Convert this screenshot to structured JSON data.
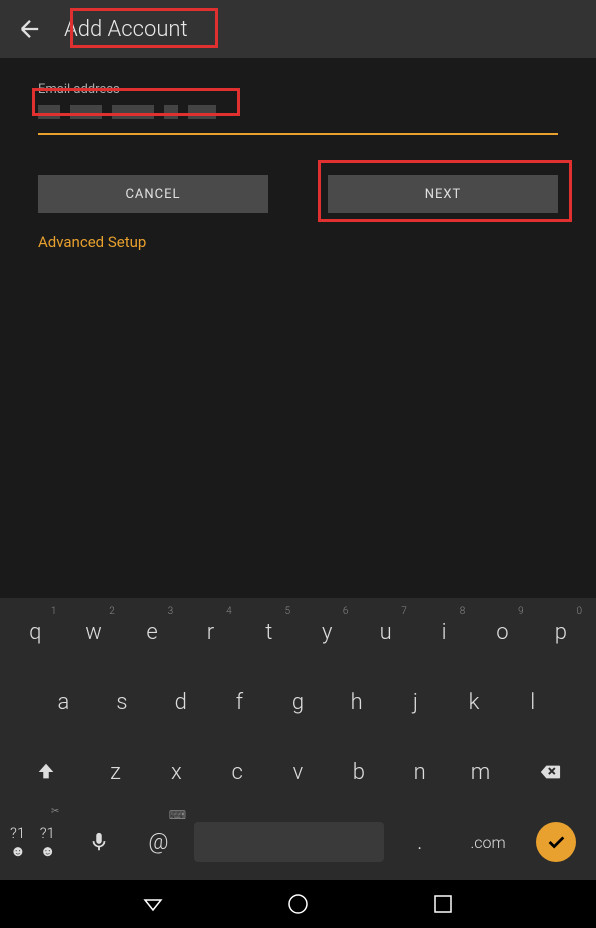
{
  "header": {
    "title": "Add Account"
  },
  "form": {
    "email_label": "Email address",
    "email_value": "",
    "cancel_label": "CANCEL",
    "next_label": "NEXT",
    "advanced_label": "Advanced Setup"
  },
  "keyboard": {
    "row1": [
      {
        "main": "q",
        "hint": "1"
      },
      {
        "main": "w",
        "hint": "2"
      },
      {
        "main": "e",
        "hint": "3"
      },
      {
        "main": "r",
        "hint": "4"
      },
      {
        "main": "t",
        "hint": "5"
      },
      {
        "main": "y",
        "hint": "6"
      },
      {
        "main": "u",
        "hint": "7"
      },
      {
        "main": "i",
        "hint": "8"
      },
      {
        "main": "o",
        "hint": "9"
      },
      {
        "main": "p",
        "hint": "0"
      }
    ],
    "row2": [
      "a",
      "s",
      "d",
      "f",
      "g",
      "h",
      "j",
      "k",
      "l"
    ],
    "row3": [
      "z",
      "x",
      "c",
      "v",
      "b",
      "n",
      "m"
    ],
    "symbols_label": "?1☻",
    "at_label": "@",
    "period_label": ".",
    "com_label": ".com"
  }
}
